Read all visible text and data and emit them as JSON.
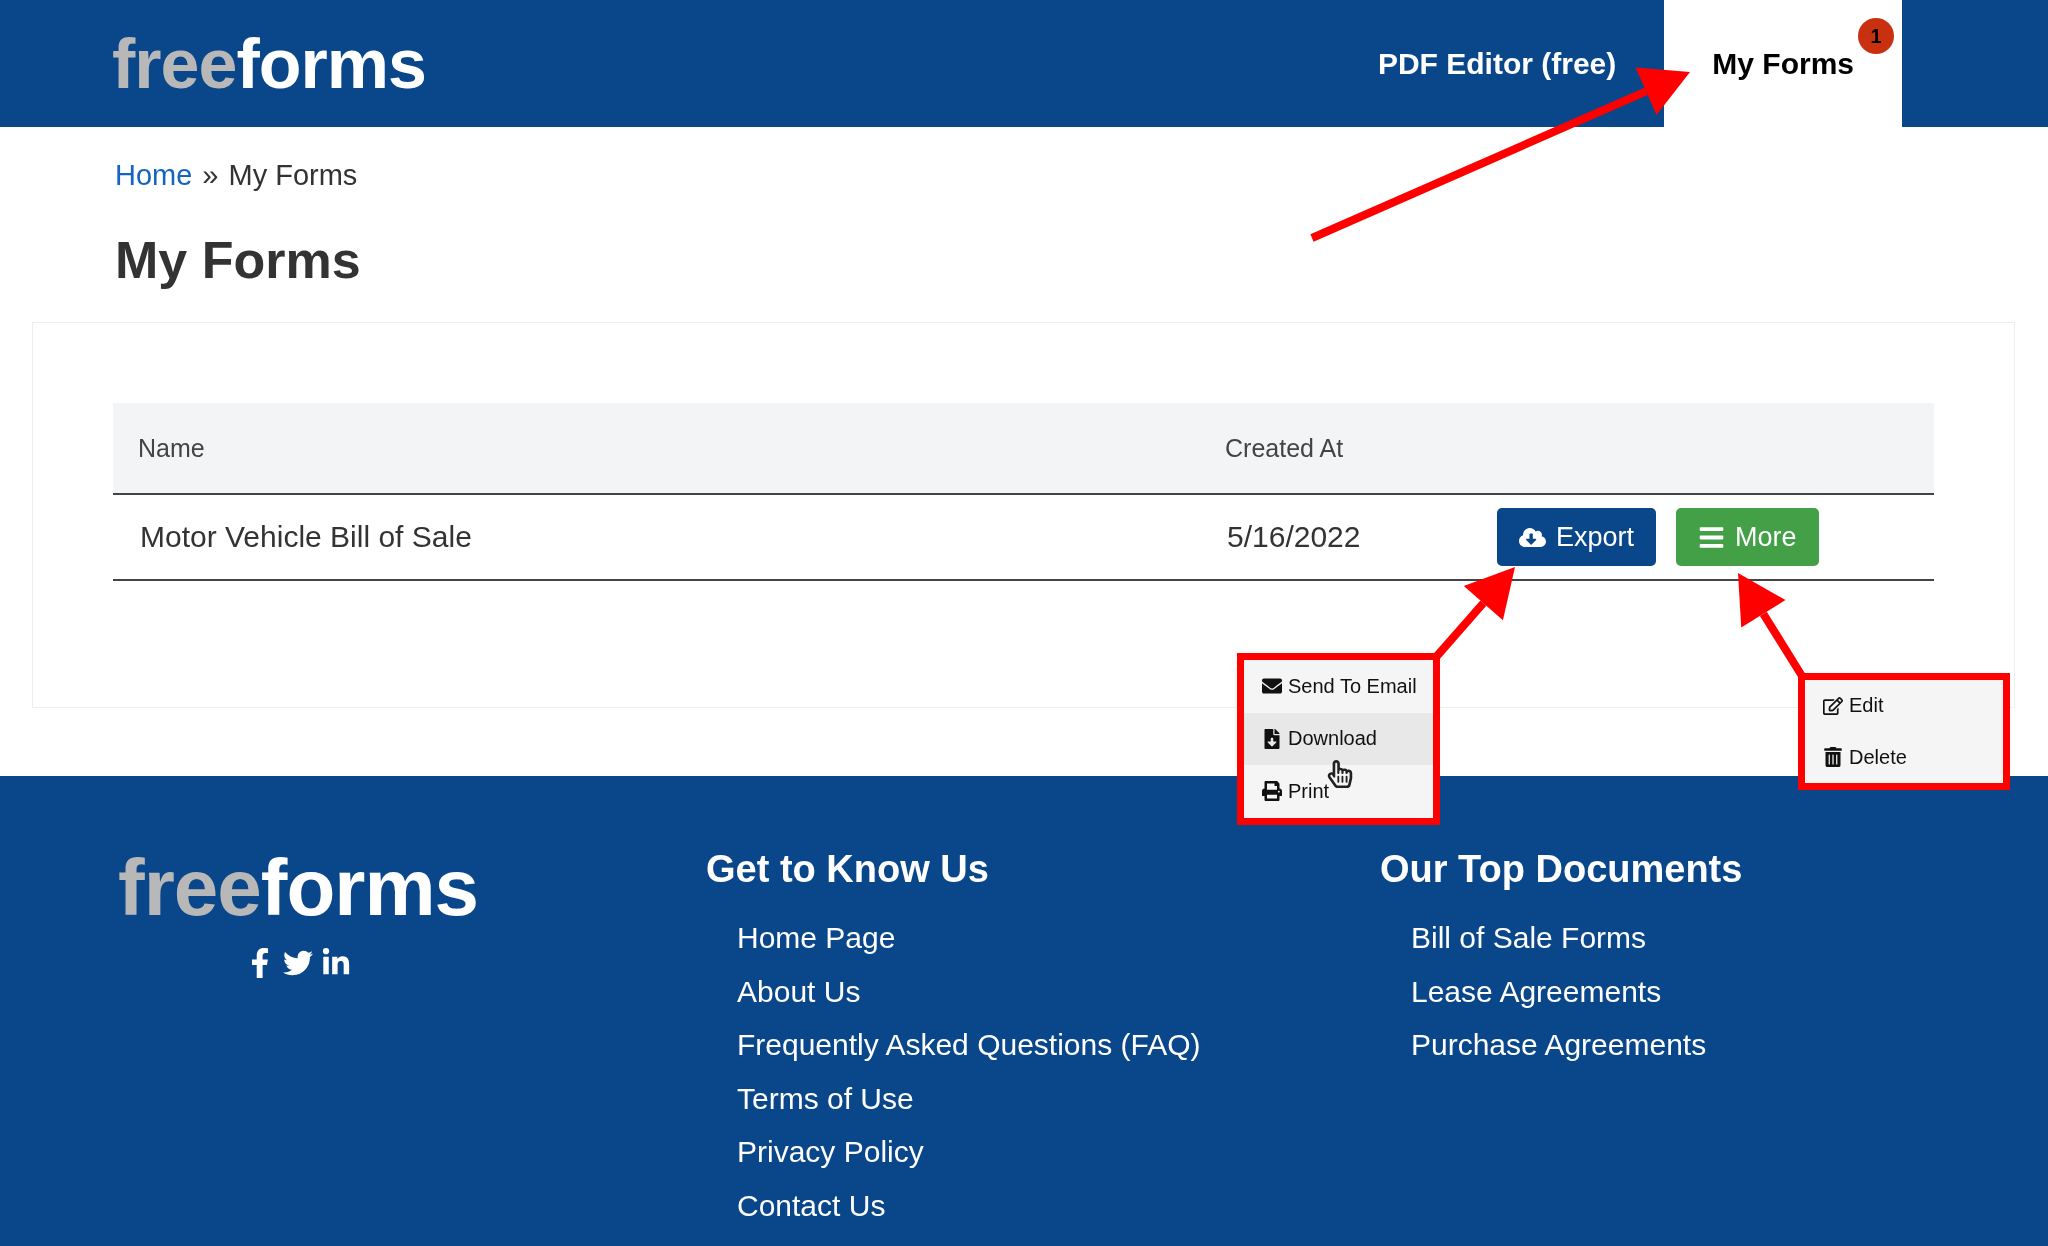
{
  "header": {
    "logo": {
      "grey_part": "free",
      "white_part": "forms"
    },
    "nav": [
      {
        "label": "PDF Editor (free)",
        "selected": false
      },
      {
        "label": "My Forms",
        "selected": true,
        "badge": "1"
      }
    ]
  },
  "breadcrumb": {
    "link": "Home",
    "separator": "»",
    "current": "My Forms"
  },
  "title": "My Forms",
  "table": {
    "columns": [
      "Name",
      "Created At"
    ],
    "rows": [
      {
        "name": "Motor Vehicle Bill of Sale",
        "created_at": "5/16/2022",
        "actions": [
          {
            "label": "Export",
            "kind": "export"
          },
          {
            "label": "More",
            "kind": "more"
          }
        ]
      }
    ]
  },
  "export_menu": {
    "items": [
      {
        "label": "Send To Email",
        "kind": "email",
        "hovered": false
      },
      {
        "label": "Download",
        "kind": "download",
        "hovered": true
      },
      {
        "label": "Print",
        "kind": "print",
        "hovered": false
      }
    ]
  },
  "more_menu": {
    "items": [
      {
        "label": "Edit",
        "kind": "edit"
      },
      {
        "label": "Delete",
        "kind": "delete"
      }
    ]
  },
  "footer": {
    "logo": {
      "grey_part": "free",
      "white_part": "forms"
    },
    "columns": [
      {
        "heading": "Get to Know Us",
        "links": [
          "Home Page",
          "About Us",
          "Frequently Asked Questions (FAQ)",
          "Terms of Use",
          "Privacy Policy",
          "Contact Us"
        ]
      },
      {
        "heading": "Our Top Documents",
        "links": [
          "Bill of Sale Forms",
          "Lease Agreements",
          "Purchase Agreements"
        ]
      }
    ]
  }
}
